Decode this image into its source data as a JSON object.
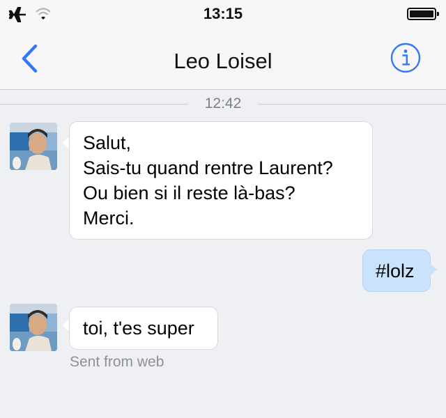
{
  "status_bar": {
    "time": "13:15",
    "icons": [
      "airplane-icon",
      "wifi-icon",
      "battery-icon"
    ]
  },
  "nav": {
    "title": "Leo Loisel",
    "back_icon": "chevron-left-icon",
    "info_icon": "info-icon"
  },
  "conversation": {
    "timestamp": "12:42",
    "messages": [
      {
        "direction": "incoming",
        "lines": [
          "Salut,",
          "Sais-tu quand rentre Laurent?",
          "Ou bien si il reste là-bas?",
          "Merci."
        ]
      },
      {
        "direction": "outgoing",
        "text": "#lolz"
      },
      {
        "direction": "incoming",
        "text": "toi, t'es super",
        "footnote": "Sent from web"
      }
    ]
  },
  "colors": {
    "accent": "#3478f6",
    "background": "#eff0f4",
    "outgoing_bubble": "#c8e3fb",
    "incoming_bubble": "#ffffff",
    "muted_text": "#8e9097"
  }
}
